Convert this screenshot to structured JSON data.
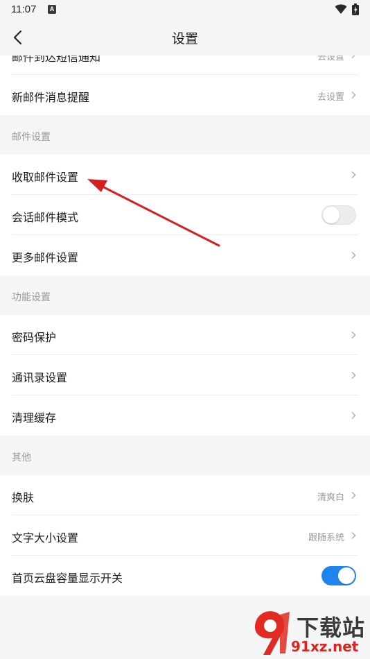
{
  "status_bar": {
    "time": "11:07",
    "notification_glyph": "A"
  },
  "nav": {
    "title": "设置"
  },
  "groups": {
    "notify": {
      "items": [
        {
          "label": "邮件到达短信通知",
          "value": "去设置"
        },
        {
          "label": "新邮件消息提醒",
          "value": "去设置"
        }
      ]
    },
    "mail": {
      "header": "邮件设置",
      "items": [
        {
          "label": "收取邮件设置"
        },
        {
          "label": "会话邮件模式",
          "toggle": false
        },
        {
          "label": "更多邮件设置"
        }
      ]
    },
    "function": {
      "header": "功能设置",
      "items": [
        {
          "label": "密码保护"
        },
        {
          "label": "通讯录设置"
        },
        {
          "label": "清理缓存"
        }
      ]
    },
    "other": {
      "header": "其他",
      "items": [
        {
          "label": "换肤",
          "value": "清爽白"
        },
        {
          "label": "文字大小设置",
          "value": "跟随系统"
        },
        {
          "label": "首页云盘容量显示开关",
          "toggle": true
        }
      ]
    }
  },
  "watermark": {
    "title": "下载站",
    "url": "91xz.net"
  },
  "colors": {
    "toggle_on": "#1f84ee",
    "annotation_arrow": "#d42020",
    "background": "#f4f5f7"
  },
  "icons": [
    "back-arrow-icon",
    "chevron-right-icon",
    "wifi-icon",
    "battery-icon"
  ]
}
